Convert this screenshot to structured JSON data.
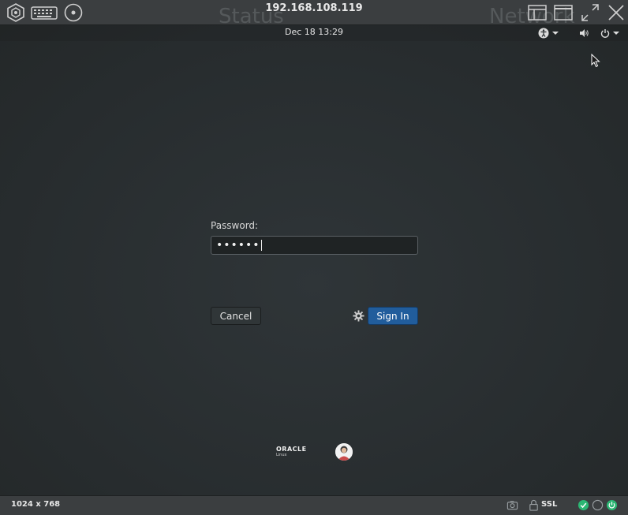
{
  "viewer": {
    "title": "192.168.108.119",
    "ghost_left": "Status",
    "ghost_right": "Network"
  },
  "topbar": {
    "clock": "Dec 18  13:29"
  },
  "login": {
    "password_label": "Password:",
    "password_value": "••••••",
    "cancel_label": "Cancel",
    "signin_label": "Sign In"
  },
  "branding": {
    "vendor": "ORACLE",
    "product": "Linux"
  },
  "statusbar": {
    "resolution": "1024 x 768",
    "ssl": "SSL"
  },
  "colors": {
    "accent": "#215d9c",
    "status_ok": "#2bb673"
  },
  "icons": [
    "settings-hex-icon",
    "keyboard-icon",
    "disc-icon",
    "window-layout-icon",
    "window-maximize-icon",
    "fullscreen-icon",
    "close-icon",
    "accessibility-icon",
    "volume-icon",
    "power-icon",
    "gear-icon",
    "camera-icon",
    "lock-icon",
    "check-circle-icon",
    "circle-icon",
    "power-circle-icon"
  ]
}
